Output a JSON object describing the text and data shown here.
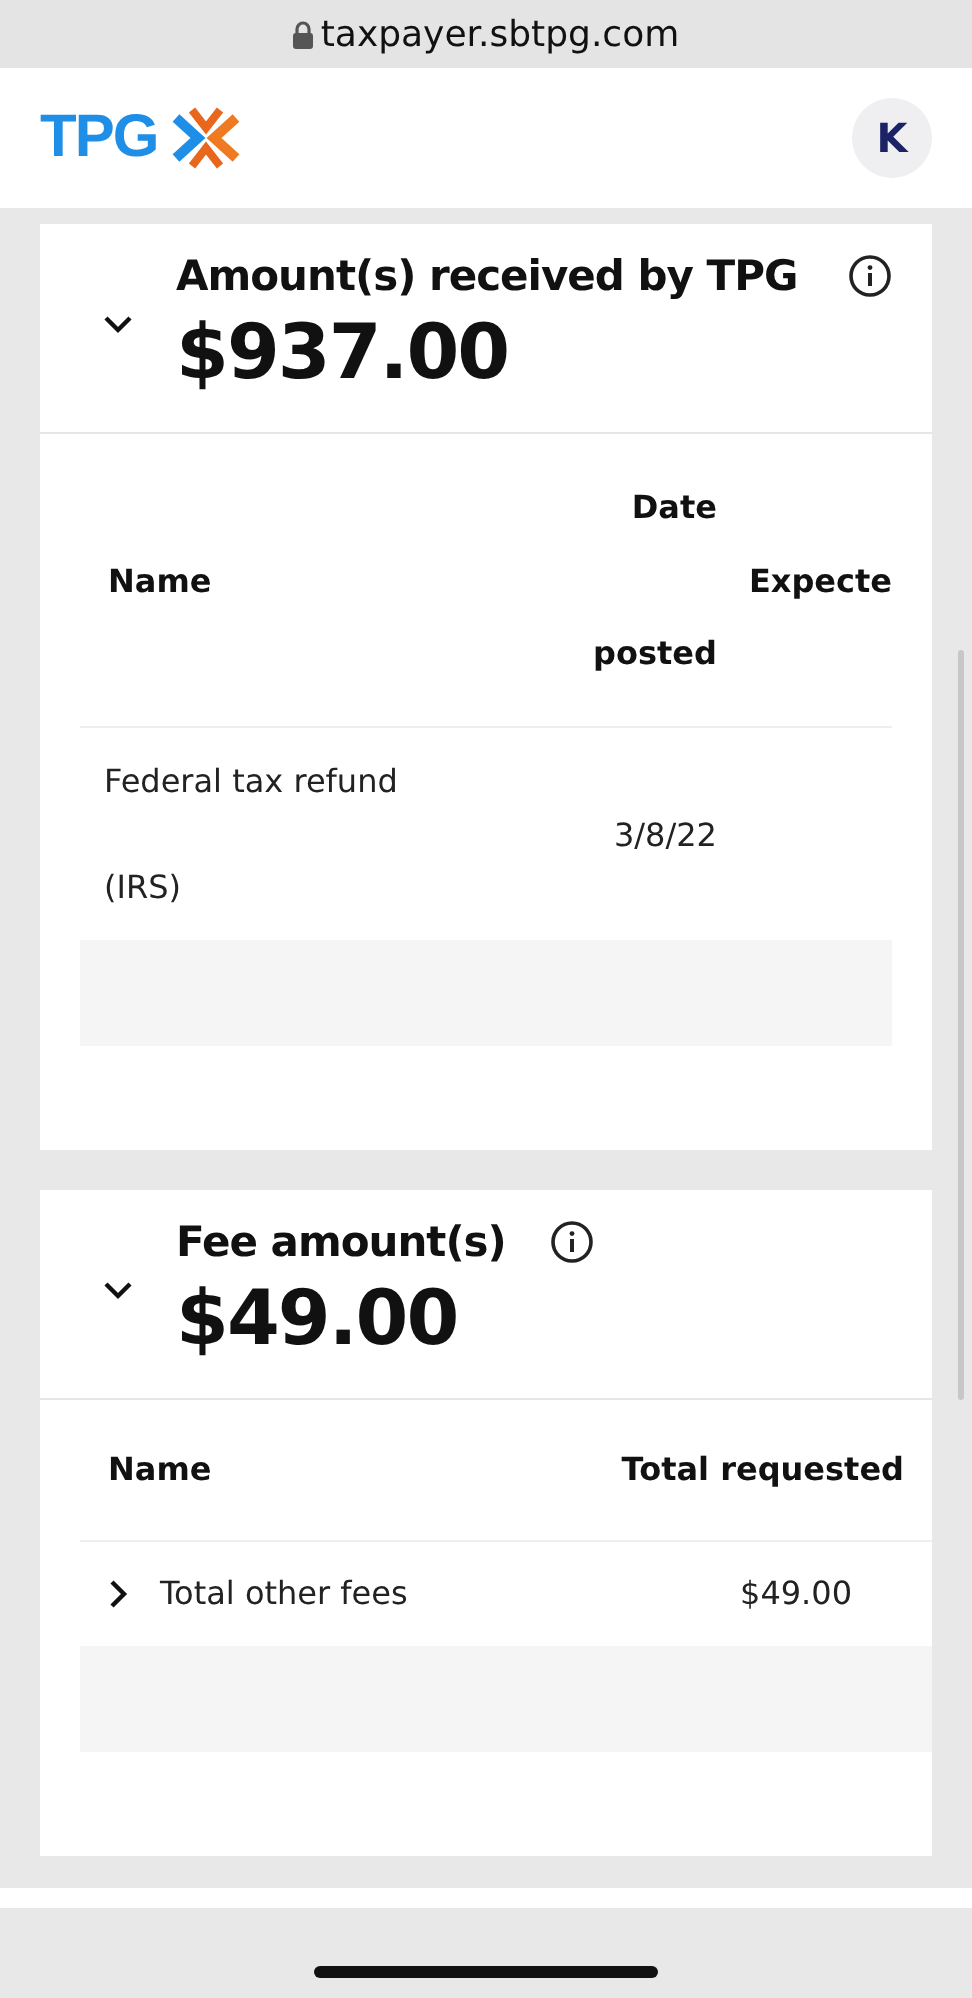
{
  "browser": {
    "url": "taxpayer.sbtpg.com"
  },
  "header": {
    "logo_text": "TPG",
    "avatar": "K"
  },
  "cards": [
    {
      "title": "Amount(s) received by TPG",
      "info": true,
      "expanded": true,
      "amount": "$937.00",
      "kind": "received",
      "columns": [
        "Name",
        "Date posted",
        "Expecte"
      ],
      "rows": [
        {
          "cells": [
            "Federal tax refund (IRS)",
            "3/8/22"
          ],
          "expandable": false
        }
      ]
    },
    {
      "title": "Fee amount(s)",
      "info": true,
      "expanded": true,
      "amount": "$49.00",
      "kind": "fees",
      "columns": [
        "Name",
        "Total requested"
      ],
      "rows": [
        {
          "cells": [
            "Total other fees",
            "$49.00"
          ],
          "expandable": true
        }
      ]
    }
  ]
}
